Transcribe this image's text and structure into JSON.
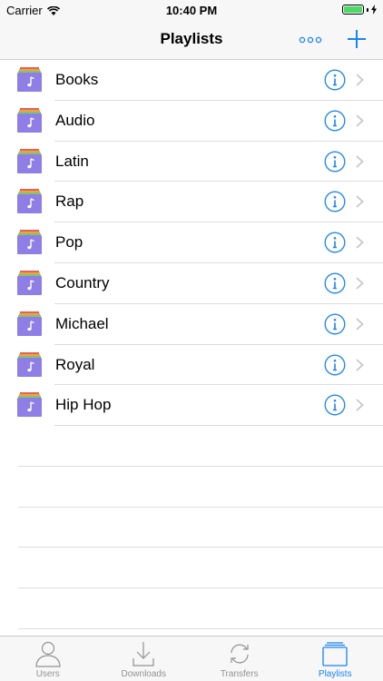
{
  "status_bar": {
    "carrier": "Carrier",
    "time": "10:40 PM",
    "battery_level": 1.0
  },
  "nav": {
    "title": "Playlists",
    "more_icon": "more-icon",
    "add_icon": "plus-icon"
  },
  "colors": {
    "accent": "#1a84f4",
    "playlist_icon": "#8e7ee6",
    "battery": "#4cd964"
  },
  "playlists": [
    {
      "label": "Books"
    },
    {
      "label": "Audio"
    },
    {
      "label": "Latin"
    },
    {
      "label": "Rap"
    },
    {
      "label": "Pop"
    },
    {
      "label": "Country"
    },
    {
      "label": "Michael"
    },
    {
      "label": "Royal"
    },
    {
      "label": "Hip Hop"
    }
  ],
  "tabs": [
    {
      "label": "Users",
      "icon": "user-icon",
      "active": false
    },
    {
      "label": "Downloads",
      "icon": "download-icon",
      "active": false
    },
    {
      "label": "Transfers",
      "icon": "sync-icon",
      "active": false
    },
    {
      "label": "Playlists",
      "icon": "playlists-icon",
      "active": true
    }
  ]
}
